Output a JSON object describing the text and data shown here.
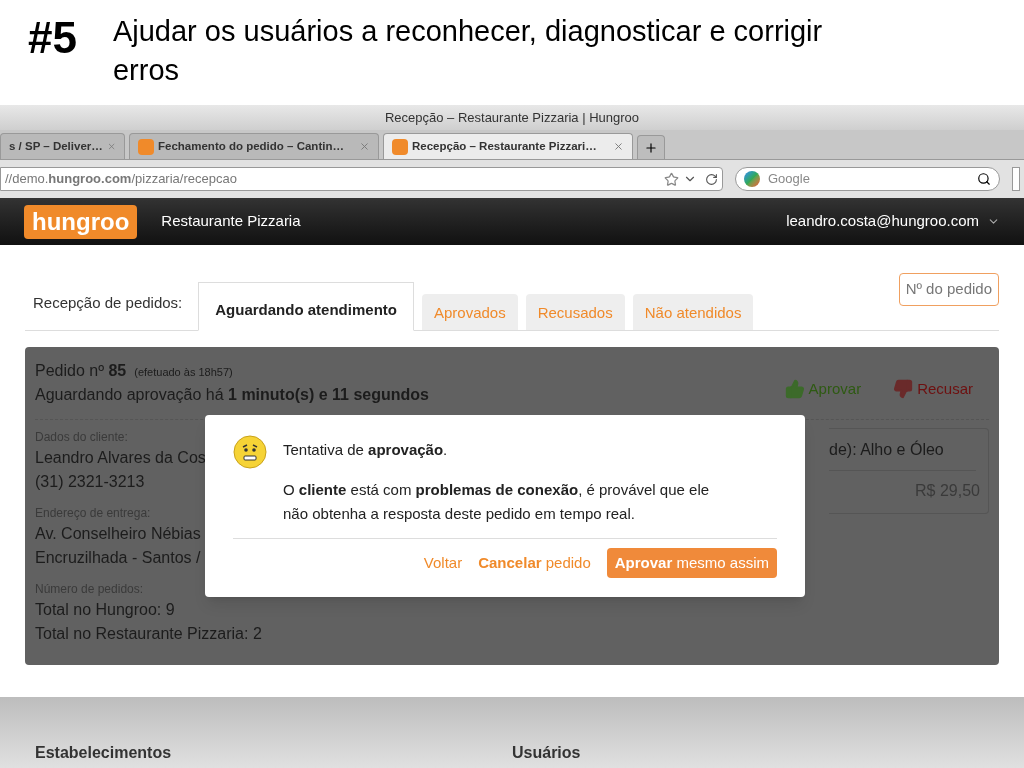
{
  "slide": {
    "number": "#5",
    "title": "Ajudar os usuários a reconhecer, diagnosticar e corrigir erros"
  },
  "browser": {
    "title": "Recepção – Restaurante Pizzaria | Hungroo",
    "tabs": [
      {
        "label": "s / SP – Deliver…",
        "selected": false,
        "has_icon": false
      },
      {
        "label": "Fechamento do pedido – Cantin…",
        "selected": false,
        "has_icon": true
      },
      {
        "label": "Recepção – Restaurante Pizzari…",
        "selected": true,
        "has_icon": true
      }
    ],
    "url": "//demo.**hungroo.com**/pizzaria/recepcao",
    "search_placeholder": "Google"
  },
  "app_header": {
    "logo": "hungroo",
    "restaurant": "Restaurante Pizzaria",
    "user": "leandro.costa@hungroo.com"
  },
  "reception": {
    "label": "Recepção de pedidos:",
    "tabs": [
      {
        "label": "Aguardando atendimento",
        "selected": true
      },
      {
        "label": "Aprovados",
        "selected": false
      },
      {
        "label": "Recusados",
        "selected": false
      },
      {
        "label": "Não atendidos",
        "selected": false
      }
    ],
    "order_search_placeholder": "Nº do pedido"
  },
  "order": {
    "heading": "Pedido nº **85**",
    "placed": "(efetuado às 18h57)",
    "waiting": "Aguardando aprovação há **1 minuto(s) e 11 segundos**",
    "actions": [
      {
        "label": "Aprovar",
        "kind": "approve"
      },
      {
        "label": "Recusar",
        "kind": "refuse"
      }
    ],
    "groups": [
      {
        "label": "Dados do cliente:",
        "lines": [
          "Leandro Alvares da Cos",
          "(31) 2321-3213"
        ]
      },
      {
        "label": "Endereço de entrega:",
        "lines": [
          "Av. Conselheiro Nébias",
          "Encruzilhada - Santos /"
        ]
      },
      {
        "label": "Número de pedidos:",
        "lines": [
          "Total no Hungroo: 9",
          "Total no Restaurante Pizzaria: 2"
        ]
      }
    ],
    "item": {
      "name": "de): Alho e Óleo",
      "price": "R$ 29,50"
    }
  },
  "dialog": {
    "title": "Tentativa de **aprovação**.",
    "message": "O **cliente** está com **problemas de conexão**, é provável que ele não obtenha a resposta deste pedido em tempo real.",
    "buttons": [
      {
        "label": "Voltar",
        "kind": "link"
      },
      {
        "label": "**Cancelar** pedido",
        "kind": "link"
      },
      {
        "label": "**Aprovar** mesmo assim",
        "kind": "primary"
      }
    ]
  },
  "footer": {
    "sections": [
      "Estabelecimentos",
      "Usuários"
    ]
  }
}
